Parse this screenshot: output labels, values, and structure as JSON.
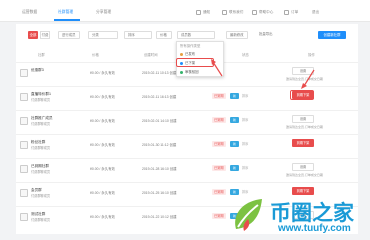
{
  "topbar": {
    "tabs": [
      {
        "label": "运营数据"
      },
      {
        "label": "社群管理"
      },
      {
        "label": "分享管理"
      }
    ],
    "right": [
      {
        "label": "通知"
      },
      {
        "label": "联系我们"
      },
      {
        "label": "帮助中心"
      },
      {
        "label": "订单"
      },
      {
        "label": "退出"
      }
    ]
  },
  "filters": {
    "tag_all": "全部",
    "tag_paid": "付费",
    "join_label": "进行成员",
    "select1": "分类",
    "select2": "排序",
    "select3": "成员数",
    "select4": "价格",
    "sort_label": "最新修改",
    "export_label": "批量导出",
    "create_button": "创建新社群"
  },
  "dropdown": {
    "header": "所有操作类型",
    "items": [
      {
        "label": "已发布",
        "color": "#e8a040"
      },
      {
        "label": "已下架",
        "color": "#1f8efa"
      },
      {
        "label": "审核驳回",
        "color": "#34b36b"
      }
    ]
  },
  "table": {
    "headers": [
      "社群",
      "价格",
      "创建时间",
      "状态",
      "操作"
    ],
    "rows": [
      {
        "name": "优惠群3",
        "sub": "",
        "price": "¥0.00 / 永久有效",
        "date": "2019-02-11 10:13 创建",
        "status": "",
        "badge": "",
        "sort": "",
        "action": "设置",
        "action_style": "plain",
        "note": "邀请到达全员,订单成交日期"
      },
      {
        "name": "直播特价群1",
        "sub": "付费群聊成员",
        "price": "¥0.00 / 永久有效",
        "date": "2019-02-11 16:13 创建",
        "status": "已到期",
        "badge": "新",
        "sort": "排序",
        "action": "到期下架",
        "action_style": "red",
        "note": ""
      },
      {
        "name": "社群推广成员",
        "sub": "付费群聊成员",
        "price": "¥0.00 / 永久有效",
        "date": "2019-02-01 14:10 创建",
        "status": "已到期",
        "badge": "新",
        "sort": "排序",
        "action": "设置",
        "action_style": "plain",
        "note": "邀请到达全员,订单成交日期"
      },
      {
        "name": "粉丝社群",
        "sub": "付费群聊成员",
        "price": "¥0.00 / 永久有效",
        "date": "2019-01-30 11:12 创建",
        "status": "已到期",
        "badge": "新",
        "sort": "排序",
        "action": "到期下架",
        "action_style": "red",
        "note": ""
      },
      {
        "name": "已到期社群",
        "sub": "付费群聊成员",
        "price": "¥0.00 / 永久有效",
        "date": "2019-01-28 16:10 创建",
        "status": "已到期",
        "badge": "新",
        "sort": "排序",
        "action": "设置",
        "action_style": "plain",
        "note": "邀请到达全员,订单成交日期"
      },
      {
        "name": "会员群",
        "sub": "付费群聊成员",
        "price": "¥0.00 / 永久有效",
        "date": "2019-01-25 16:10 创建",
        "status": "已到期",
        "badge": "新",
        "sort": "排序",
        "action": "到期下架",
        "action_style": "red",
        "note": ""
      },
      {
        "name": "测试社群",
        "sub": "付费群聊成员",
        "price": "¥0.00 / 永久有效",
        "date": "2019-01-22 10:12 创建",
        "status": "已到期",
        "badge": "新",
        "sort": "排序",
        "action": "设置",
        "action_style": "plain",
        "note": ""
      }
    ]
  },
  "watermark": {
    "brand": "币圈之家",
    "url": "www.tuufy.com",
    "colors": {
      "brand": "#1a9ad6",
      "leaf": "#7cc242",
      "flame": "#e84c4c"
    }
  },
  "colors": {
    "accent": "#1f8efa",
    "danger": "#e84c4c",
    "background": "#f2f3f5"
  }
}
